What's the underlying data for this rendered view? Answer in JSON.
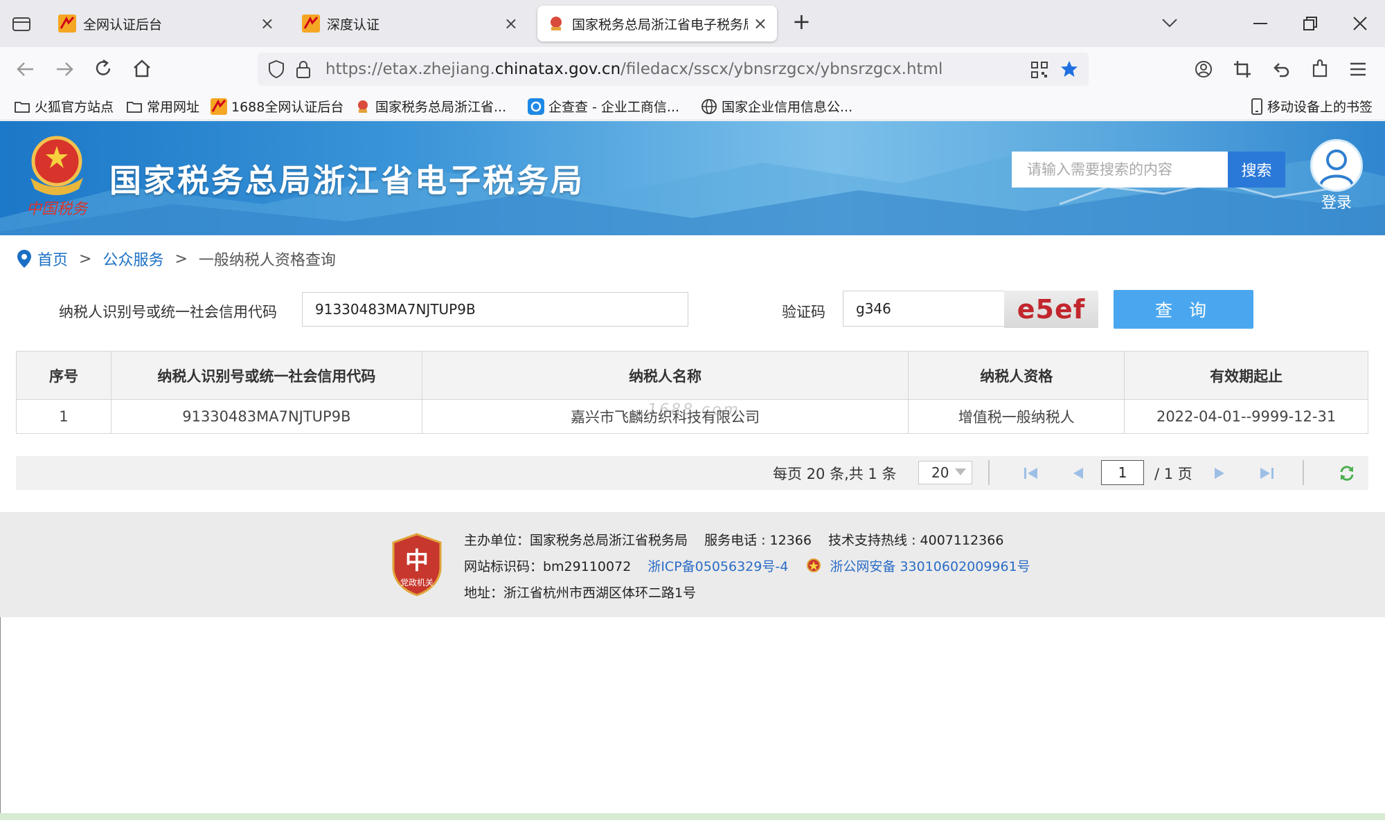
{
  "browser": {
    "tabs": [
      {
        "title": "全网认证后台",
        "close": "×"
      },
      {
        "title": "深度认证",
        "close": "×"
      },
      {
        "title": "国家税务总局浙江省电子税务局",
        "close": "×"
      }
    ],
    "new_tab": "+",
    "url_prefix": "https://etax.zhejiang.",
    "url_domain": "chinatax.gov.cn",
    "url_path": "/filedacx/sscx/ybnsrzgcx/ybnsrzgcx.html",
    "bookmarks": [
      "火狐官方站点",
      "常用网址",
      "1688全网认证后台",
      "国家税务总局浙江省...",
      "企查查 - 企业工商信...",
      "国家企业信用信息公..."
    ],
    "mobile_bookmarks": "移动设备上的书签"
  },
  "header": {
    "site_title": "国家税务总局浙江省电子税务局",
    "search_placeholder": "请输入需要搜索的内容",
    "search_button": "搜索",
    "login_label": "登录"
  },
  "breadcrumb": {
    "home": "首页",
    "separator": ">",
    "section": "公众服务",
    "current": "一般纳税人资格查询"
  },
  "form": {
    "taxpayer_id_label": "纳税人识别号或统一社会信用代码",
    "taxpayer_id_value": "91330483MA7NJTUP9B",
    "captcha_label": "验证码",
    "captcha_value": "g346",
    "captcha_image_text": "e5ef",
    "query_button": "查 询"
  },
  "table": {
    "headers": [
      "序号",
      "纳税人识别号或统一社会信用代码",
      "纳税人名称",
      "纳税人资格",
      "有效期起止"
    ],
    "rows": [
      [
        "1",
        "91330483MA7NJTUP9B",
        "嘉兴市飞麟纺织科技有限公司",
        "增值税一般纳税人",
        "2022-04-01--9999-12-31"
      ]
    ],
    "watermark": "1688.com"
  },
  "pagination": {
    "summary": "每页 20 条,共 1 条",
    "page_size": "20",
    "current_page": "1",
    "total_pages": "/ 1 页"
  },
  "footer": {
    "host_label": "主办单位：国家税务总局浙江省税务局",
    "service_phone": "服务电话 : 12366",
    "support_hotline": "技术支持热线 : 4007112366",
    "site_code": "网站标识码：bm29110072",
    "icp": "浙ICP备05056329号-4",
    "police_record": "浙公网安备 33010602009961号",
    "address": "地址：浙江省杭州市西湖区体环二路1号",
    "badge_text": "党政机关"
  },
  "colors": {
    "primary_blue": "#1a6fc4",
    "query_button": "#4aa7ef",
    "captcha_red": "#c1272d"
  }
}
